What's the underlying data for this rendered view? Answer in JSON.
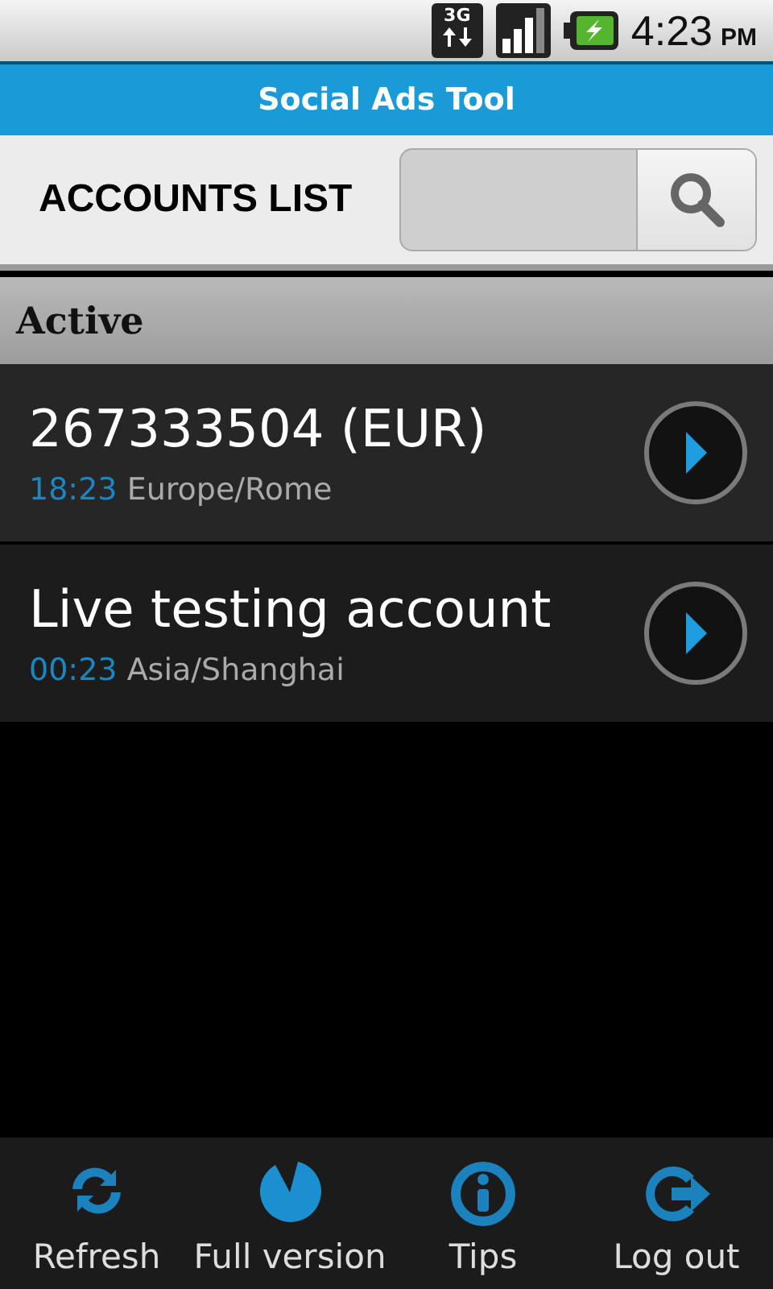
{
  "status_bar": {
    "network_type": "3G",
    "time": "4:23",
    "period": "PM"
  },
  "app_title": "Social Ads Tool",
  "header": {
    "title": "ACCOUNTS LIST"
  },
  "section": {
    "title": "Active"
  },
  "accounts": [
    {
      "name": "267333504 (EUR)",
      "time": "18:23",
      "timezone": "Europe/Rome"
    },
    {
      "name": "Live testing account",
      "time": "00:23",
      "timezone": "Asia/Shanghai"
    }
  ],
  "toolbar": [
    {
      "kind": "refresh",
      "label": "Refresh"
    },
    {
      "kind": "chart",
      "label": "Full version"
    },
    {
      "kind": "info",
      "label": "Tips"
    },
    {
      "kind": "logout",
      "label": "Log out"
    }
  ]
}
